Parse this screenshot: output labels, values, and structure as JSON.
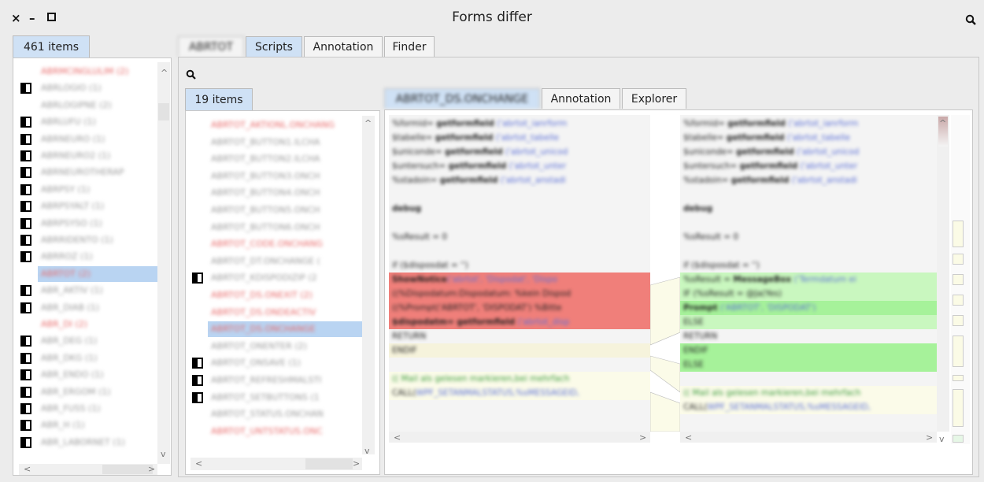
{
  "window": {
    "title": "Forms differ"
  },
  "left_pane": {
    "tab": "461 items",
    "items": [
      {
        "label": "ABRMCINGLULIM (2)",
        "color": "red",
        "marker": false
      },
      {
        "label": "ABRLOGIO (1)",
        "color": "gray",
        "marker": true
      },
      {
        "label": "ABRLOGIPNE (2)",
        "color": "gray",
        "marker": false
      },
      {
        "label": "ABRLUFU (1)",
        "color": "gray",
        "marker": true
      },
      {
        "label": "ABRNEURO (1)",
        "color": "gray",
        "marker": true
      },
      {
        "label": "ABRNEURO2 (1)",
        "color": "gray",
        "marker": true
      },
      {
        "label": "ABRNEUROTHERAP",
        "color": "gray",
        "marker": true
      },
      {
        "label": "ABRPSY (1)",
        "color": "gray",
        "marker": true
      },
      {
        "label": "ABRPSYALT (1)",
        "color": "gray",
        "marker": true
      },
      {
        "label": "ABRPSYSO (1)",
        "color": "gray",
        "marker": true
      },
      {
        "label": "ABRRIDENTO (1)",
        "color": "gray",
        "marker": true
      },
      {
        "label": "ABRROZ (1)",
        "color": "gray",
        "marker": true
      },
      {
        "label": "ABRTOT (2)",
        "color": "red",
        "marker": false,
        "selected": true
      },
      {
        "label": "ABR_AKTIV (1)",
        "color": "gray",
        "marker": true
      },
      {
        "label": "ABR_DIAB (1)",
        "color": "gray",
        "marker": true
      },
      {
        "label": "ABR_DI (2)",
        "color": "red",
        "marker": false
      },
      {
        "label": "ABR_DEG (1)",
        "color": "gray",
        "marker": true
      },
      {
        "label": "ABR_DKG (1)",
        "color": "gray",
        "marker": true
      },
      {
        "label": "ABR_ENDO (1)",
        "color": "gray",
        "marker": true
      },
      {
        "label": "ABR_ERGOM (1)",
        "color": "gray",
        "marker": true
      },
      {
        "label": "ABR_FUSS (1)",
        "color": "gray",
        "marker": true
      },
      {
        "label": "ABR_H (1)",
        "color": "gray",
        "marker": true
      },
      {
        "label": "ABR_LABORNET (1)",
        "color": "gray",
        "marker": true
      }
    ]
  },
  "main_tabs": [
    "ABRTOT",
    "Scripts",
    "Annotation",
    "Finder"
  ],
  "scripts_pane": {
    "tab": "19 items",
    "items": [
      {
        "label": "ABRTOT_AKTIONL.ONCHANG",
        "color": "red",
        "marker": false
      },
      {
        "label": "ABRTOT_BUTTON1.ILCHA",
        "color": "gray",
        "marker": false
      },
      {
        "label": "ABRTOT_BUTTON2.ILCHA",
        "color": "gray",
        "marker": false
      },
      {
        "label": "ABRTOT_BUTTON3.ONCH",
        "color": "gray",
        "marker": false
      },
      {
        "label": "ABRTOT_BUTTON4.ONCH",
        "color": "gray",
        "marker": false
      },
      {
        "label": "ABRTOT_BUTTON5.ONCH",
        "color": "gray",
        "marker": false
      },
      {
        "label": "ABRTOT_BUTTON6.ONCH",
        "color": "gray",
        "marker": false
      },
      {
        "label": "ABRTOT_CODE.ONCHANG",
        "color": "red",
        "marker": false
      },
      {
        "label": "ABRTOT_DT.ONCHANGE (",
        "color": "gray",
        "marker": false
      },
      {
        "label": "ABRTOT_KDISPODIZIP (2",
        "color": "gray",
        "marker": true
      },
      {
        "label": "ABRTOT_DS.ONEXIT (2)",
        "color": "red",
        "marker": false
      },
      {
        "label": "ABRTOT_DS.ONDEACTIV",
        "color": "red",
        "marker": false
      },
      {
        "label": "ABRTOT_DS.ONCHANGE",
        "color": "red",
        "marker": false,
        "selected": true
      },
      {
        "label": "ABRTOT_ONENTER (2)",
        "color": "gray",
        "marker": false
      },
      {
        "label": "ABRTOT_ONSAVE (1)",
        "color": "gray",
        "marker": true
      },
      {
        "label": "ABRTOT_REFRESHMALSTI",
        "color": "gray",
        "marker": true
      },
      {
        "label": "ABRTOT_SETBUTTONS (1",
        "color": "gray",
        "marker": true
      },
      {
        "label": "ABRTOT_STATUS.ONCHAN",
        "color": "gray",
        "marker": false
      },
      {
        "label": "ABRTOT_UNTSTATUS.ONC",
        "color": "red",
        "marker": false
      }
    ]
  },
  "diff_tabs": [
    "ABRTOT_DS.ONCHANGE",
    "Annotation",
    "Explorer"
  ],
  "diff": {
    "left_lines": [
      {
        "bg": "",
        "parts": [
          [
            "t",
            "%formid= "
          ],
          [
            "k",
            "getformfield"
          ],
          [
            "b",
            " ('abrtot_ianrform"
          ]
        ]
      },
      {
        "bg": "",
        "parts": [
          [
            "t",
            "$tabelle= "
          ],
          [
            "k",
            "getformfield"
          ],
          [
            "b",
            " ('abrtot_tabelle"
          ]
        ]
      },
      {
        "bg": "",
        "parts": [
          [
            "t",
            "$uniconde= "
          ],
          [
            "k",
            "getformfield"
          ],
          [
            "b",
            " ('abrtot_unicod"
          ]
        ]
      },
      {
        "bg": "",
        "parts": [
          [
            "t",
            "$untersuch= "
          ],
          [
            "k",
            "getformfield"
          ],
          [
            "b",
            " ('abrtot_unter"
          ]
        ]
      },
      {
        "bg": "",
        "parts": [
          [
            "t",
            "%stadoin= "
          ],
          [
            "k",
            "getformfield"
          ],
          [
            "b",
            " ('abrtot_anstadi"
          ]
        ]
      },
      {
        "bg": "",
        "parts": [
          [
            "t",
            ""
          ]
        ]
      },
      {
        "bg": "",
        "parts": [
          [
            "k",
            "debug"
          ]
        ]
      },
      {
        "bg": "",
        "parts": [
          [
            "t",
            ""
          ]
        ]
      },
      {
        "bg": "",
        "parts": [
          [
            "t",
            "%sResult = 0"
          ]
        ]
      },
      {
        "bg": "",
        "parts": [
          [
            "t",
            ""
          ]
        ]
      },
      {
        "bg": "",
        "parts": [
          [
            "t",
            "if ($disposdat = '')"
          ]
        ]
      },
      {
        "bg": "red",
        "parts": [
          [
            "k",
            "  ShowNotice"
          ],
          [
            "b",
            "('abrtot', 'Dispodat', 'Dispo"
          ]
        ]
      },
      {
        "bg": "red",
        "parts": [
          [
            "t",
            "  ((%Dispodatum:Dispodatum: %kein Dispod"
          ]
        ]
      },
      {
        "bg": "red",
        "parts": [
          [
            "t",
            "  ((%Prompt('ABRTOT', 'DISPODAT') %Bitte "
          ]
        ]
      },
      {
        "bg": "red",
        "parts": [
          [
            "k",
            "  $dispodatm= getformfield"
          ],
          [
            "b",
            " ('abrtot_disp"
          ]
        ]
      },
      {
        "bg": "",
        "parts": [
          [
            "t",
            "  RETURN"
          ]
        ]
      },
      {
        "bg": "pale",
        "parts": [
          [
            "t",
            "ENDIF"
          ]
        ]
      },
      {
        "bg": "",
        "parts": [
          [
            "t",
            ""
          ]
        ]
      },
      {
        "bg": "yellow",
        "parts": [
          [
            "g",
            "(( Mail als gelesen markieren,bei mehrfach"
          ]
        ]
      },
      {
        "bg": "yellow",
        "parts": [
          [
            "t",
            "CALL("
          ],
          [
            "b",
            "WPF_SETANMALSTATUS,%sMESSAGEID,"
          ]
        ]
      }
    ],
    "right_lines": [
      {
        "bg": "",
        "parts": [
          [
            "t",
            "%formid= "
          ],
          [
            "k",
            "getformfield"
          ],
          [
            "b",
            " ('abrtot_ianrform"
          ]
        ]
      },
      {
        "bg": "",
        "parts": [
          [
            "t",
            "$tabelle= "
          ],
          [
            "k",
            "getformfield"
          ],
          [
            "b",
            " ('abrtot_tabelle"
          ]
        ]
      },
      {
        "bg": "",
        "parts": [
          [
            "t",
            "$uniconde= "
          ],
          [
            "k",
            "getformfield"
          ],
          [
            "b",
            " ('abrtot_unicod"
          ]
        ]
      },
      {
        "bg": "",
        "parts": [
          [
            "t",
            "$untersuch= "
          ],
          [
            "k",
            "getformfield"
          ],
          [
            "b",
            " ('abrtot_unter"
          ]
        ]
      },
      {
        "bg": "",
        "parts": [
          [
            "t",
            "%stadoin= "
          ],
          [
            "k",
            "getformfield"
          ],
          [
            "b",
            " ('abrtot_anstadi"
          ]
        ]
      },
      {
        "bg": "",
        "parts": [
          [
            "t",
            ""
          ]
        ]
      },
      {
        "bg": "",
        "parts": [
          [
            "k",
            "debug"
          ]
        ]
      },
      {
        "bg": "",
        "parts": [
          [
            "t",
            ""
          ]
        ]
      },
      {
        "bg": "",
        "parts": [
          [
            "t",
            "%sResult = 0"
          ]
        ]
      },
      {
        "bg": "",
        "parts": [
          [
            "t",
            ""
          ]
        ]
      },
      {
        "bg": "",
        "parts": [
          [
            "t",
            "if ($disposdat = '')"
          ]
        ]
      },
      {
        "bg": "green2",
        "parts": [
          [
            "t",
            "  %sResult = "
          ],
          [
            "k",
            "MessageBox"
          ],
          [
            "b",
            " ('Termdatum ei"
          ]
        ]
      },
      {
        "bg": "green2",
        "parts": [
          [
            "t",
            "  IF (%sResult = @Ja(Yes)"
          ]
        ]
      },
      {
        "bg": "green",
        "parts": [
          [
            "k",
            "    Prompt"
          ],
          [
            "b",
            " ('ABRTOT', 'DISPODAT')"
          ]
        ]
      },
      {
        "bg": "green2",
        "parts": [
          [
            "t",
            "  ELSE"
          ]
        ]
      },
      {
        "bg": "",
        "parts": [
          [
            "t",
            "    RETURN"
          ]
        ]
      },
      {
        "bg": "green",
        "parts": [
          [
            "t",
            "  ENDIF"
          ]
        ]
      },
      {
        "bg": "green",
        "parts": [
          [
            "t",
            "ELSE"
          ]
        ]
      },
      {
        "bg": "",
        "parts": [
          [
            "t",
            ""
          ]
        ]
      },
      {
        "bg": "yellow",
        "parts": [
          [
            "g",
            "(( Mail als gelesen markieren,bei mehrfach"
          ]
        ]
      },
      {
        "bg": "yellow",
        "parts": [
          [
            "t",
            "CALL("
          ],
          [
            "b",
            "WPF_SETANMALSTATUS,%sMESSAGEID,"
          ]
        ]
      }
    ]
  },
  "icons": {
    "close": "close-icon",
    "minimize": "minimize-icon",
    "maximize": "maximize-icon",
    "search": "search-icon"
  }
}
